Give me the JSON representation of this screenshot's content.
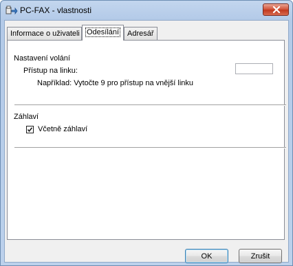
{
  "window": {
    "title": "PC-FAX - vlastnosti",
    "title_icon": "pc-fax-icon",
    "close_icon": "close-icon"
  },
  "tabs": [
    {
      "label": "Informace o uživateli",
      "active": false
    },
    {
      "label": "Odesílání",
      "active": true
    },
    {
      "label": "Adresář",
      "active": false
    }
  ],
  "dialing": {
    "section_label": "Nastavení volání",
    "line_access_label": "Přístup na linku:",
    "line_access_value": "",
    "example_text": "Například: Vytočte 9 pro přístup na vnější linku"
  },
  "header": {
    "section_label": "Záhlaví",
    "include_header_label": "Včetně záhlaví",
    "include_header_checked": true
  },
  "buttons": {
    "ok_label": "OK",
    "cancel_label": "Zrušit"
  }
}
